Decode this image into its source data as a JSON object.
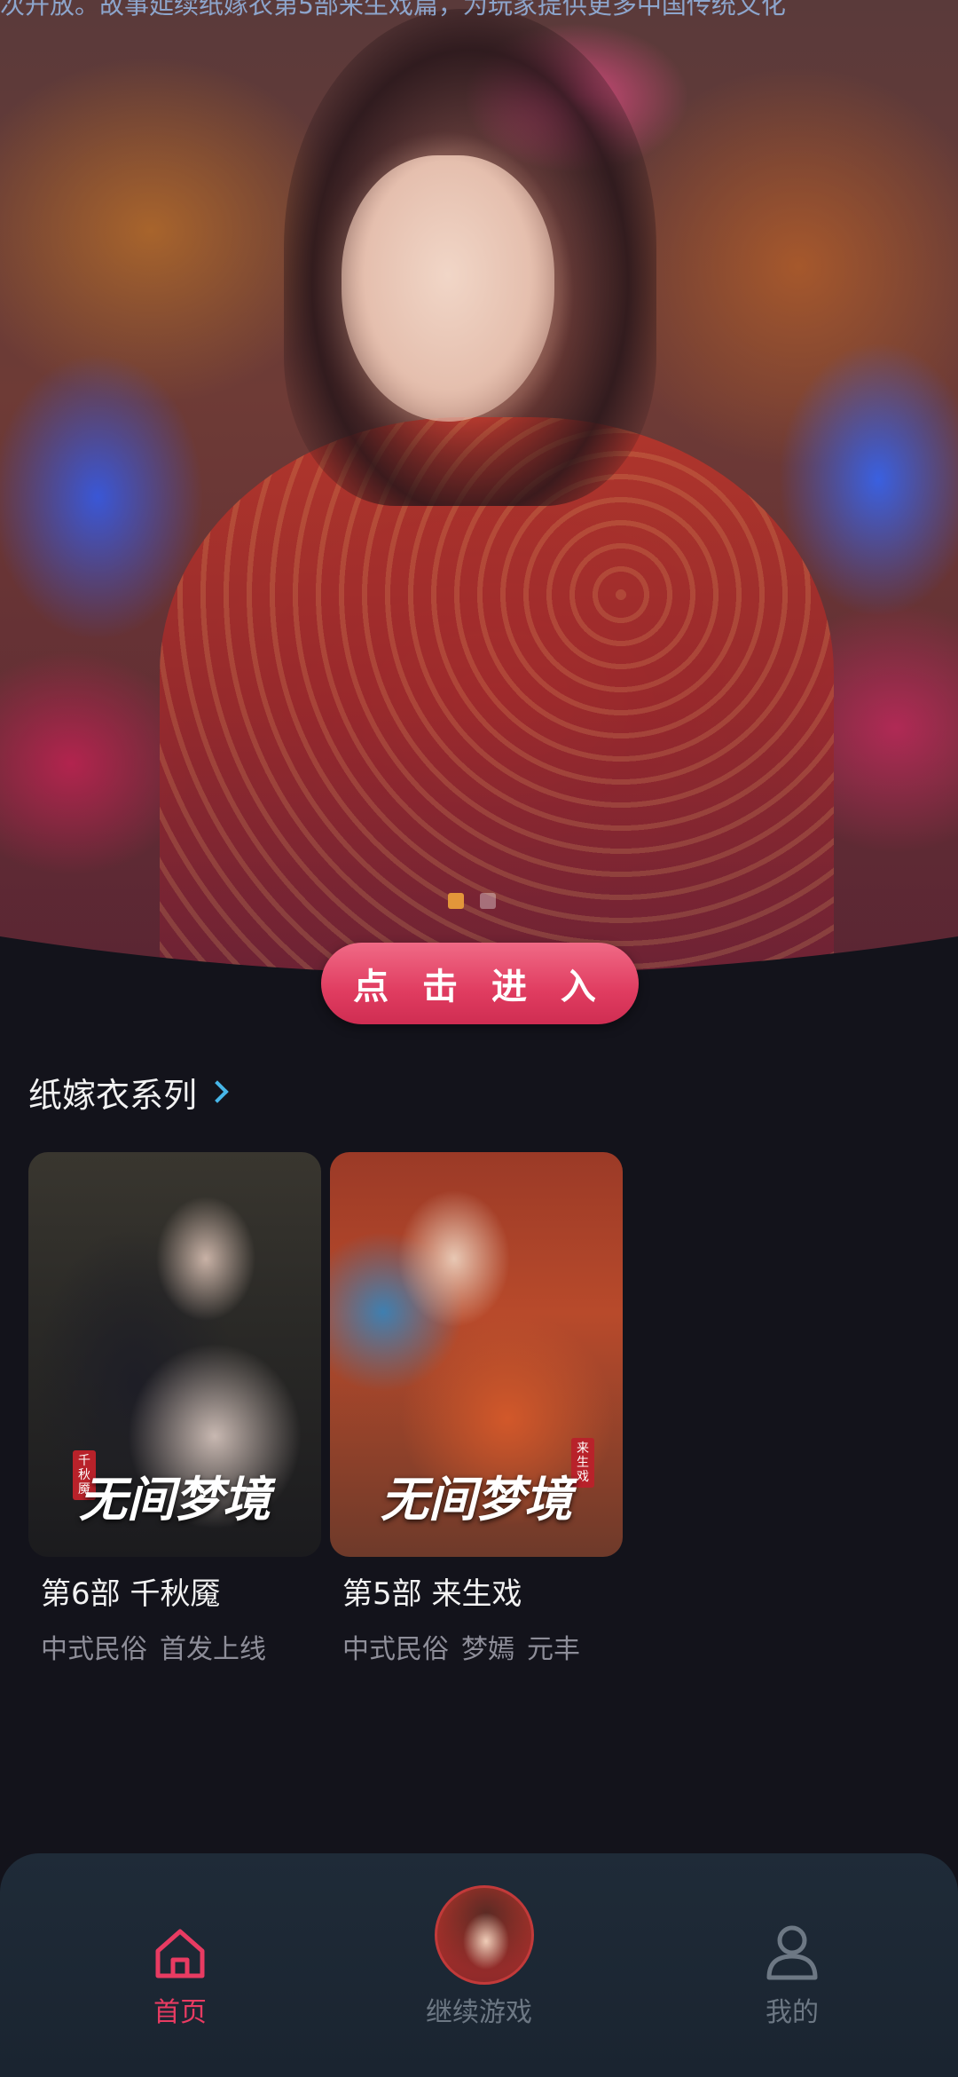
{
  "hero": {
    "top_text": "次开放。故事延续纸嫁衣第5部来生戏篇，为玩家提供更多中国传统文化",
    "enter_label": "点 击 进 入",
    "slides": [
      {
        "active": true
      },
      {
        "active": false
      }
    ]
  },
  "section": {
    "title": "纸嫁衣系列"
  },
  "cards": [
    {
      "title": "第6部 千秋魇",
      "tags": [
        "中式民俗",
        "首发上线"
      ],
      "cover_logo": "无间梦境",
      "cover_badge": "千秋魇"
    },
    {
      "title": "第5部 来生戏",
      "tags": [
        "中式民俗",
        "梦嫣",
        "元丰"
      ],
      "cover_logo": "无间梦境",
      "cover_badge": "来生戏"
    }
  ],
  "nav": {
    "home": "首页",
    "continue": "继续游戏",
    "me": "我的"
  },
  "colors": {
    "accent": "#e83b62",
    "background": "#13131b",
    "nav_background": "#1f2b38",
    "link_chevron": "#47b6e8",
    "muted_text": "#8e8e99"
  },
  "icons": {
    "home": "home-icon",
    "me": "user-icon",
    "section": "chevron-right-icon"
  }
}
